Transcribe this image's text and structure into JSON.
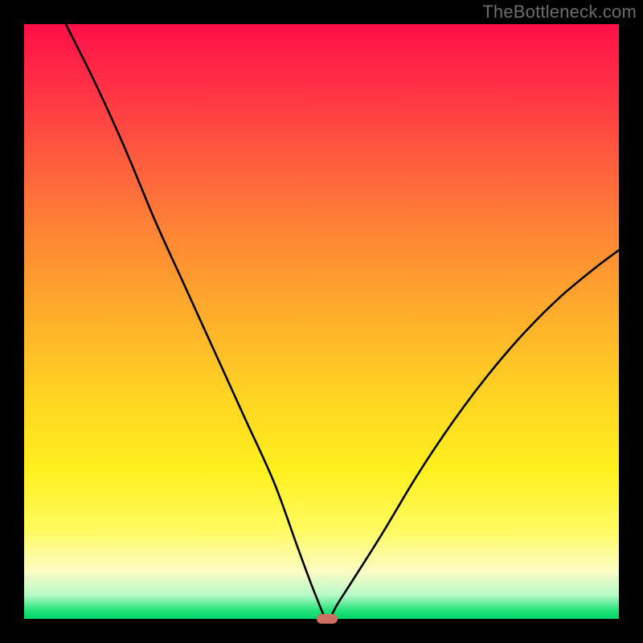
{
  "watermark": "TheBottleneck.com",
  "chart_data": {
    "type": "line",
    "title": "",
    "xlabel": "",
    "ylabel": "",
    "xlim": [
      0,
      100
    ],
    "ylim": [
      0,
      100
    ],
    "grid": false,
    "legend": false,
    "series": [
      {
        "name": "curve",
        "x": [
          7,
          12,
          17,
          22,
          27,
          32,
          37,
          42,
          46,
          49,
          51,
          53,
          60,
          66,
          72,
          78,
          84,
          90,
          96,
          100
        ],
        "values": [
          100,
          90,
          79,
          67,
          56,
          45,
          34,
          23,
          12,
          4,
          0,
          3,
          14,
          24,
          33,
          41,
          48,
          54,
          59,
          62
        ]
      }
    ],
    "marker": {
      "x": 51,
      "y": 0
    },
    "background_gradient": {
      "stops": [
        {
          "pos": 0,
          "color": "#ff1048"
        },
        {
          "pos": 0.1,
          "color": "#ff2f46"
        },
        {
          "pos": 0.22,
          "color": "#ff5a3f"
        },
        {
          "pos": 0.35,
          "color": "#ff8535"
        },
        {
          "pos": 0.5,
          "color": "#ffb12b"
        },
        {
          "pos": 0.63,
          "color": "#ffd523"
        },
        {
          "pos": 0.75,
          "color": "#fff01e"
        },
        {
          "pos": 0.85,
          "color": "#fffb60"
        },
        {
          "pos": 0.92,
          "color": "#fcfcc5"
        },
        {
          "pos": 0.96,
          "color": "#b7f9c9"
        },
        {
          "pos": 0.985,
          "color": "#28e47a"
        },
        {
          "pos": 1.0,
          "color": "#00d46a"
        }
      ]
    }
  }
}
